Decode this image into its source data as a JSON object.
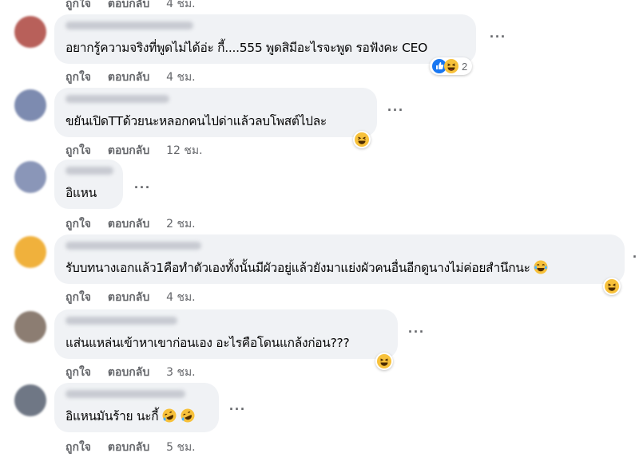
{
  "comments": [
    {
      "text": "",
      "like_label": "ถูกใจ",
      "reply_label": "ตอบกลับ",
      "time": "4 ชม."
    },
    {
      "text": "อยากรู้ความจริงที่พูดไม่ได้อ่ะ กี้....555 พูดสิมีอะไรจะพูด รอฟังคะ CEO",
      "like_label": "ถูกใจ",
      "reply_label": "ตอบกลับ",
      "time": "4 ชม.",
      "reaction_count": "2",
      "more": "···"
    },
    {
      "text": "ขยันเปิดTTด้วยนะหลอกคนไปด่าแล้วลบโพสต์ไปละ",
      "like_label": "ถูกใจ",
      "reply_label": "ตอบกลับ",
      "time": "12 ชม.",
      "more": "···"
    },
    {
      "text": "อิแหน",
      "like_label": "ถูกใจ",
      "reply_label": "ตอบกลับ",
      "time": "2 ชม.",
      "more": "···"
    },
    {
      "text": "รับบทนางเอกแล้ว1คือทำตัวเองทั้งนั้นมีผัวอยู่แล้วยังมาแย่งผัวคนอื่นอีกดูนางไม่ค่อยสำนึกนะ",
      "like_label": "ถูกใจ",
      "reply_label": "ตอบกลับ",
      "time": "4 ชม.",
      "more": "···"
    },
    {
      "text": "แส่นแหล่นเข้าหาเขาก่อนเอง อะไรคือโดนแกล้งก่อน???",
      "like_label": "ถูกใจ",
      "reply_label": "ตอบกลับ",
      "time": "3 ชม.",
      "more": "···"
    },
    {
      "text": "อิแหนมันร้าย นะกี้",
      "like_label": "ถูกใจ",
      "reply_label": "ตอบกลับ",
      "time": "5 ชม.",
      "more": "···"
    }
  ],
  "colors": {
    "bubble": "#f0f2f5",
    "secondary_text": "#65676b",
    "like_blue": "#1877f2",
    "haha_yellow": "#f7c13b"
  },
  "icons": {
    "like": "thumbs-up-icon",
    "haha": "laughing-emoji-icon",
    "cry_laugh": "tears-of-joy-emoji-icon",
    "more": "more-options-icon"
  }
}
